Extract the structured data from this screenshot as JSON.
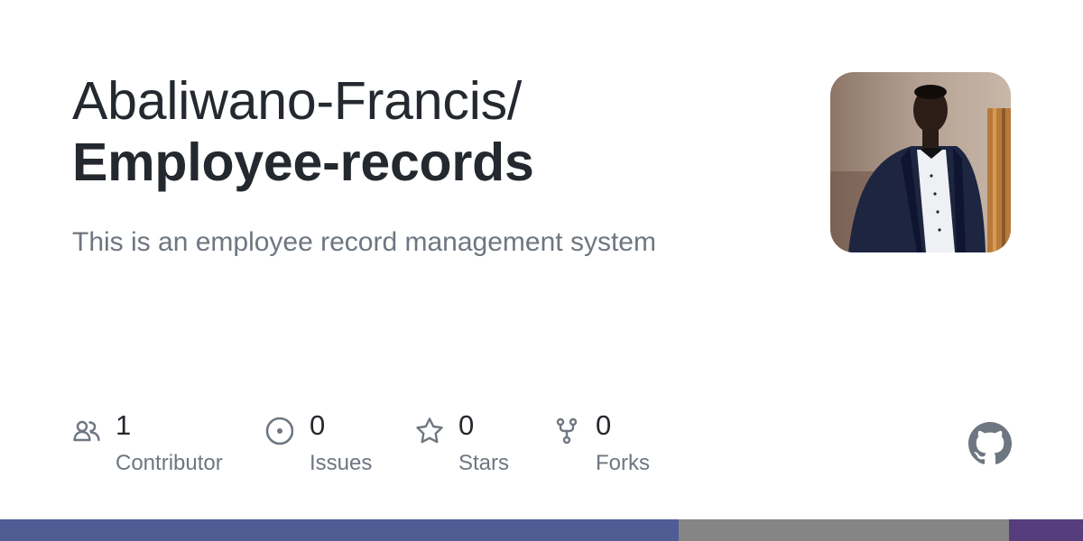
{
  "repo": {
    "owner": "Abaliwano-Francis/",
    "name": "Employee-records",
    "description": "This is an employee record management system"
  },
  "avatar": {
    "icon": "user-avatar-photo"
  },
  "stats": [
    {
      "count": "1",
      "label": "Contributor",
      "icon": "people-icon"
    },
    {
      "count": "0",
      "label": "Issues",
      "icon": "issue-opened-icon"
    },
    {
      "count": "0",
      "label": "Stars",
      "icon": "star-icon"
    },
    {
      "count": "0",
      "label": "Forks",
      "icon": "repo-forked-icon"
    }
  ],
  "logo": {
    "icon": "github-mark-icon",
    "color": "#6e7681"
  },
  "language_bar": [
    {
      "share": 0.627,
      "color": "#4f5d95"
    },
    {
      "share": 0.305,
      "color": "#858585"
    },
    {
      "share": 0.068,
      "color": "#563d7c"
    }
  ],
  "colors": {
    "text_primary": "#24292f",
    "text_secondary": "#6e7681",
    "icon": "#6e7681"
  }
}
